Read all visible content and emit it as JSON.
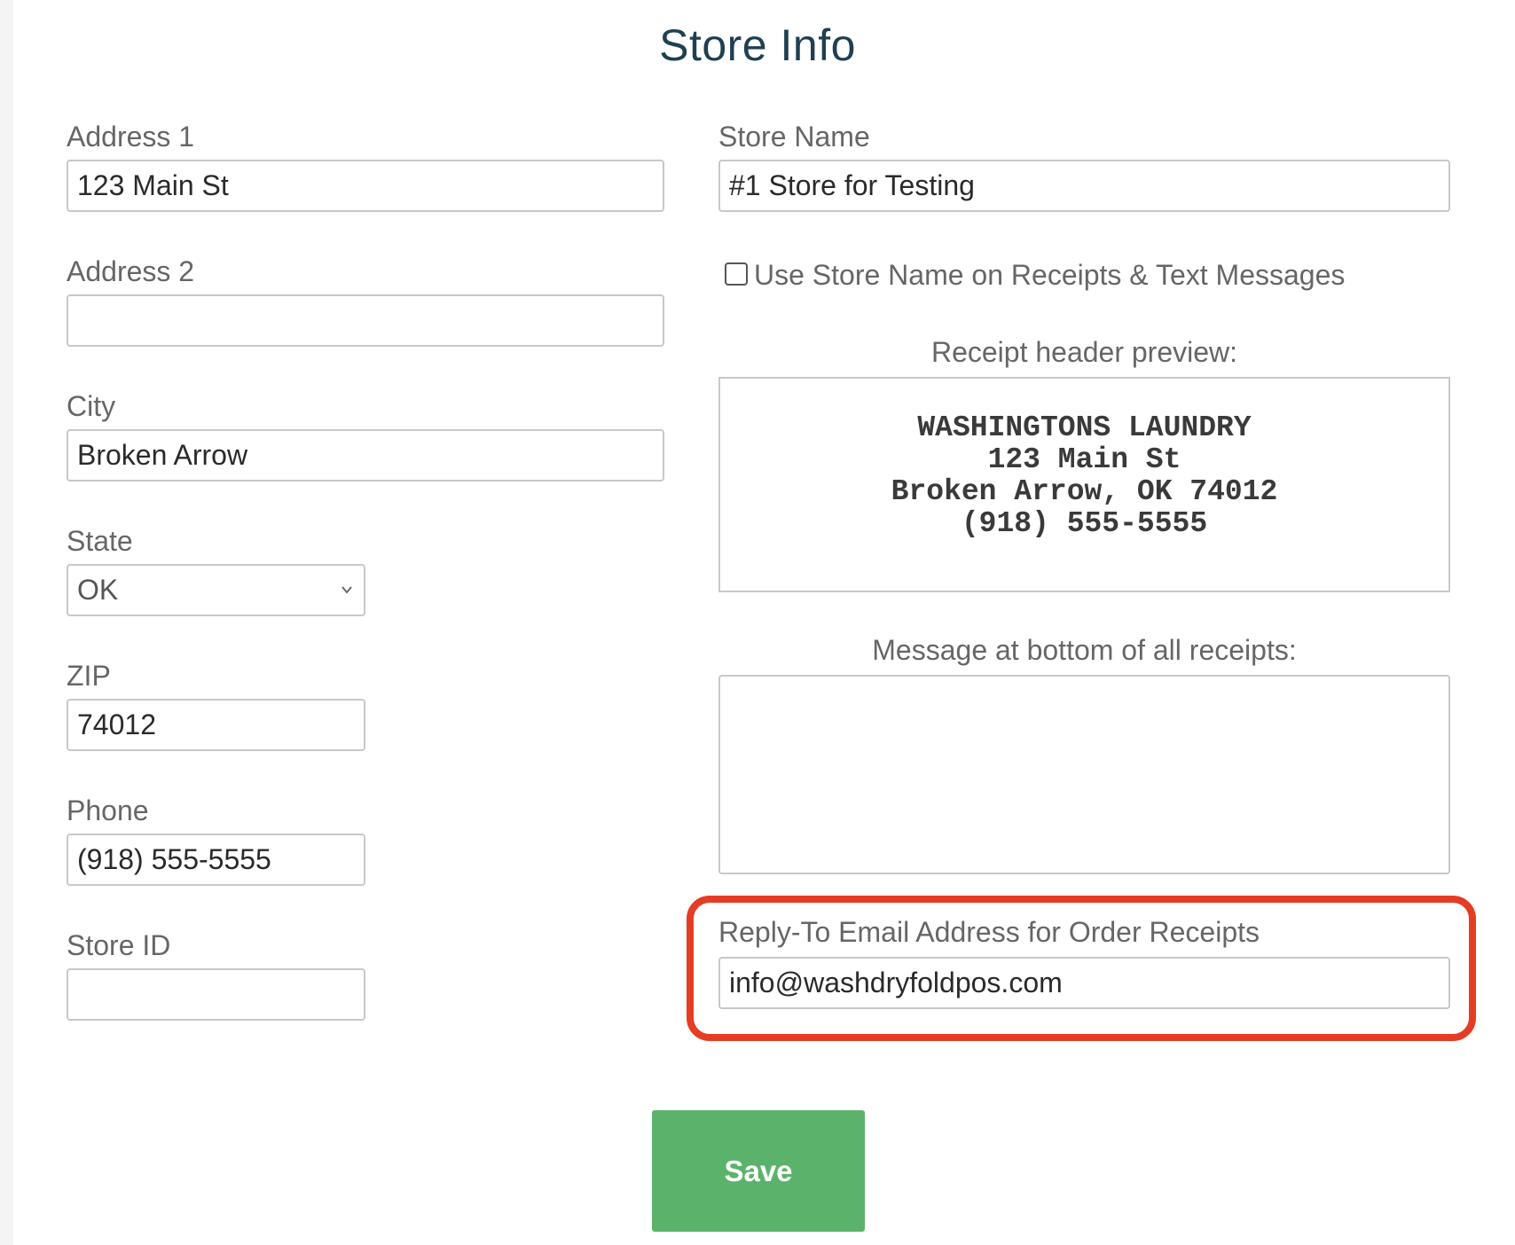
{
  "page": {
    "title": "Store Info"
  },
  "left": {
    "address1": {
      "label": "Address 1",
      "value": "123 Main St"
    },
    "address2": {
      "label": "Address 2",
      "value": ""
    },
    "city": {
      "label": "City",
      "value": "Broken Arrow"
    },
    "state": {
      "label": "State",
      "value": "OK",
      "icon": "chevron-down-icon"
    },
    "zip": {
      "label": "ZIP",
      "value": "74012"
    },
    "phone": {
      "label": "Phone",
      "value": "(918) 555-5555"
    },
    "store_id": {
      "label": "Store ID",
      "value": ""
    }
  },
  "right": {
    "store_name": {
      "label": "Store Name",
      "value": "#1 Store for Testing"
    },
    "use_store_name": {
      "label": "Use Store Name on Receipts & Text Messages",
      "checked": false
    },
    "receipt_preview": {
      "label": "Receipt header preview:",
      "lines": [
        "WASHINGTONS LAUNDRY",
        "123 Main St",
        "Broken Arrow, OK 74012",
        "(918) 555-5555"
      ]
    },
    "bottom_message": {
      "label": "Message at bottom of all receipts:",
      "value": ""
    },
    "reply_to": {
      "label": "Reply-To Email Address for Order Receipts",
      "value": "info@washdryfoldpos.com"
    }
  },
  "actions": {
    "save_label": "Save"
  },
  "colors": {
    "title": "#1f3f52",
    "highlight": "#e53d25",
    "save_button": "#5bb36b"
  }
}
